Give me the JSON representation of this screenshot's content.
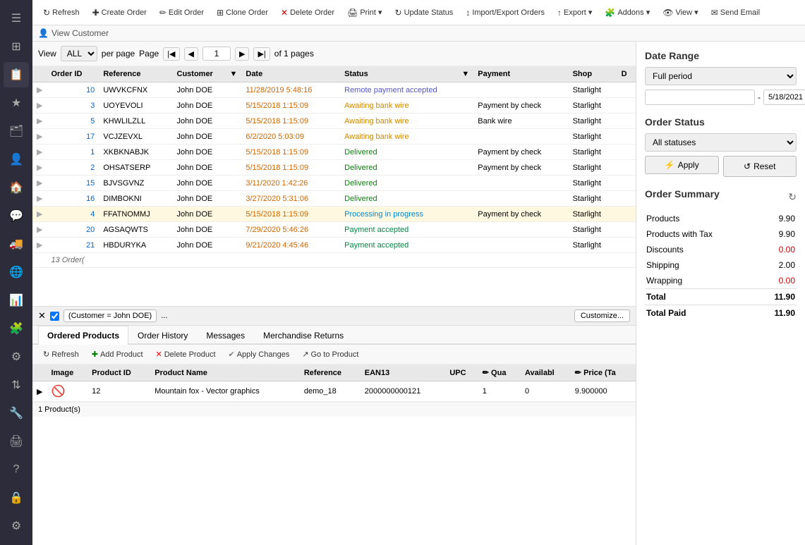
{
  "sidebar": {
    "icons": [
      {
        "name": "hamburger-icon",
        "symbol": "☰"
      },
      {
        "name": "dashboard-icon",
        "symbol": "⊞"
      },
      {
        "name": "orders-icon",
        "symbol": "📋"
      },
      {
        "name": "favorites-icon",
        "symbol": "★"
      },
      {
        "name": "catalog-icon",
        "symbol": "🗂"
      },
      {
        "name": "customers-icon",
        "symbol": "👤"
      },
      {
        "name": "home-icon",
        "symbol": "🏠"
      },
      {
        "name": "messages-icon",
        "symbol": "💬"
      },
      {
        "name": "shipping-icon",
        "symbol": "🚚"
      },
      {
        "name": "globe-icon",
        "symbol": "🌐"
      },
      {
        "name": "analytics-icon",
        "symbol": "📊"
      },
      {
        "name": "puzzle-icon",
        "symbol": "🧩"
      },
      {
        "name": "settings2-icon",
        "symbol": "⚙"
      },
      {
        "name": "transfer-icon",
        "symbol": "⇅"
      },
      {
        "name": "tools-icon",
        "symbol": "🔧"
      },
      {
        "name": "print2-icon",
        "symbol": "🖨"
      },
      {
        "name": "help-icon",
        "symbol": "?"
      },
      {
        "name": "lock-icon",
        "symbol": "🔒"
      },
      {
        "name": "gear-icon",
        "symbol": "⚙"
      }
    ]
  },
  "toolbar": {
    "buttons": [
      {
        "label": "Refresh",
        "icon": "↻",
        "name": "refresh-btn"
      },
      {
        "label": "Create Order",
        "icon": "✚",
        "name": "create-order-btn"
      },
      {
        "label": "Edit Order",
        "icon": "✏",
        "name": "edit-order-btn"
      },
      {
        "label": "Clone Order",
        "icon": "⊞",
        "name": "clone-order-btn"
      },
      {
        "label": "Delete Order",
        "icon": "✕",
        "name": "delete-order-btn"
      },
      {
        "label": "Print ▾",
        "icon": "🖨",
        "name": "print-btn"
      },
      {
        "label": "Update Status",
        "icon": "↻",
        "name": "update-status-btn"
      },
      {
        "label": "Import/Export Orders",
        "icon": "↕",
        "name": "import-export-btn"
      },
      {
        "label": "Export ▾",
        "icon": "↑",
        "name": "export-btn"
      },
      {
        "label": "Addons ▾",
        "icon": "🧩",
        "name": "addons-btn"
      },
      {
        "label": "View ▾",
        "icon": "👁",
        "name": "view-btn"
      },
      {
        "label": "Send Email",
        "icon": "✉",
        "name": "send-email-btn"
      }
    ]
  },
  "sub_toolbar": {
    "view_customer_label": "View Customer"
  },
  "pagination": {
    "view_label": "View",
    "view_value": "ALL",
    "per_page_label": "per page",
    "page_label": "Page",
    "current_page": "1",
    "of_label": "of 1 pages"
  },
  "orders_table": {
    "columns": [
      "Order ID",
      "Reference",
      "Customer",
      "Date",
      "Status",
      "Payment",
      "Shop",
      "D"
    ],
    "rows": [
      {
        "id": "10",
        "reference": "UWVKCFNX",
        "customer": "John DOE",
        "date": "11/28/2019 5:48:16",
        "status": "Remote payment accepted",
        "status_class": "status-remote",
        "payment": "",
        "shop": "Starlight",
        "d": ""
      },
      {
        "id": "3",
        "reference": "UOYEVOLI",
        "customer": "John DOE",
        "date": "5/15/2018 1:15:09",
        "status": "Awaiting bank wire",
        "status_class": "status-awaiting",
        "payment": "Payment by check",
        "shop": "Starlight",
        "d": ""
      },
      {
        "id": "5",
        "reference": "KHWLILZLL",
        "customer": "John DOE",
        "date": "5/15/2018 1:15:09",
        "status": "Awaiting bank wire",
        "status_class": "status-awaiting",
        "payment": "Bank wire",
        "shop": "Starlight",
        "d": ""
      },
      {
        "id": "17",
        "reference": "VCJZEVXL",
        "customer": "John DOE",
        "date": "6/2/2020 5:03:09",
        "status": "Awaiting bank wire",
        "status_class": "status-awaiting",
        "payment": "",
        "shop": "Starlight",
        "d": ""
      },
      {
        "id": "1",
        "reference": "XKBKNABJK",
        "customer": "John DOE",
        "date": "5/15/2018 1:15:09",
        "status": "Delivered",
        "status_class": "status-delivered",
        "payment": "Payment by check",
        "shop": "Starlight",
        "d": ""
      },
      {
        "id": "2",
        "reference": "OHSATSERP",
        "customer": "John DOE",
        "date": "5/15/2018 1:15:09",
        "status": "Delivered",
        "status_class": "status-delivered",
        "payment": "Payment by check",
        "shop": "Starlight",
        "d": ""
      },
      {
        "id": "15",
        "reference": "BJVSGVNZ",
        "customer": "John DOE",
        "date": "3/11/2020 1:42:26",
        "status": "Delivered",
        "status_class": "status-delivered",
        "payment": "",
        "shop": "Starlight",
        "d": ""
      },
      {
        "id": "16",
        "reference": "DIMBOKNI",
        "customer": "John DOE",
        "date": "3/27/2020 5:31:06",
        "status": "Delivered",
        "status_class": "status-delivered",
        "payment": "",
        "shop": "Starlight",
        "d": ""
      },
      {
        "id": "4",
        "reference": "FFATNOMMJ",
        "customer": "John DOE",
        "date": "5/15/2018 1:15:09",
        "status": "Processing in progress",
        "status_class": "status-processing",
        "payment": "Payment by check",
        "shop": "Starlight",
        "d": "",
        "selected": true
      },
      {
        "id": "20",
        "reference": "AGSAQWTS",
        "customer": "John DOE",
        "date": "7/29/2020 5:46:26",
        "status": "Payment accepted",
        "status_class": "status-accepted",
        "payment": "",
        "shop": "Starlight",
        "d": ""
      },
      {
        "id": "21",
        "reference": "HBDURYKA",
        "customer": "John DOE",
        "date": "9/21/2020 4:45:46",
        "status": "Payment accepted",
        "status_class": "status-accepted",
        "payment": "",
        "shop": "Starlight",
        "d": ""
      }
    ],
    "count_label": "13 Order("
  },
  "filter_bar": {
    "filter_text": "(Customer = John DOE)",
    "customize_label": "Customize..."
  },
  "tabs": [
    {
      "label": "Ordered Products",
      "name": "tab-ordered-products",
      "active": true
    },
    {
      "label": "Order History",
      "name": "tab-order-history",
      "active": false
    },
    {
      "label": "Messages",
      "name": "tab-messages",
      "active": false
    },
    {
      "label": "Merchandise Returns",
      "name": "tab-merchandise-returns",
      "active": false
    }
  ],
  "sub_section_toolbar": {
    "buttons": [
      {
        "label": "Refresh",
        "icon": "↻",
        "name": "products-refresh-btn"
      },
      {
        "label": "Add Product",
        "icon": "✚",
        "name": "add-product-btn"
      },
      {
        "label": "Delete Product",
        "icon": "✕",
        "name": "delete-product-btn"
      },
      {
        "label": "Apply Changes",
        "icon": "✔",
        "name": "apply-changes-btn"
      },
      {
        "label": "Go to Product",
        "icon": "↗",
        "name": "go-to-product-btn"
      }
    ]
  },
  "products_table": {
    "columns": [
      "Image",
      "Product ID",
      "Product Name",
      "Reference",
      "EAN13",
      "UPC",
      "Qua",
      "Availabl",
      "Price (Ta"
    ],
    "rows": [
      {
        "image": "🚫",
        "product_id": "12",
        "product_name": "Mountain fox - Vector graphics",
        "reference": "demo_18",
        "ean13": "2000000000121",
        "upc": "",
        "quantity": "1",
        "available": "0",
        "price": "9.900000"
      }
    ],
    "count_label": "1 Product(s)"
  },
  "right_panel": {
    "date_range_title": "Date Range",
    "full_period_label": "Full period",
    "date_from": "",
    "date_to": "5/18/2021",
    "order_status_title": "Order Status",
    "all_statuses_label": "All statuses",
    "apply_label": "Apply",
    "reset_label": "Reset",
    "order_summary_title": "Order Summary",
    "summary_rows": [
      {
        "label": "Products",
        "value": "9.90"
      },
      {
        "label": "Products with Tax",
        "value": "9.90"
      },
      {
        "label": "Discounts",
        "value": "0.00"
      },
      {
        "label": "Shipping",
        "value": "2.00"
      },
      {
        "label": "Wrapping",
        "value": "0.00"
      },
      {
        "label": "Total",
        "value": "11.90"
      },
      {
        "label": "Total Paid",
        "value": "11.90"
      }
    ]
  }
}
